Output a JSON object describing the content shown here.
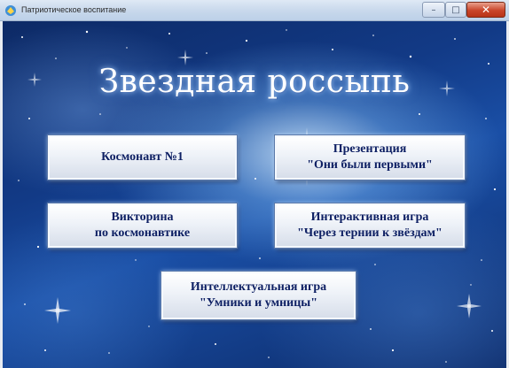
{
  "window": {
    "title": "Патриотическое воспитание",
    "icon": "app-icon",
    "controls": {
      "minimize": "–",
      "maximize": "□",
      "close": "✕"
    }
  },
  "main": {
    "heading": "Звездная россыпь",
    "buttons": [
      {
        "line1": "Космонавт №1",
        "line2": ""
      },
      {
        "line1": "Презентация",
        "line2": "\"Они были первыми\""
      },
      {
        "line1": "Викторина",
        "line2": "по космонавтике"
      },
      {
        "line1": "Интерактивная игра",
        "line2": "\"Через тернии к звёздам\""
      },
      {
        "line1": "Интеллектуальная игра",
        "line2": "\"Умники и умницы\""
      }
    ]
  },
  "colors": {
    "button_text": "#0d1f63",
    "background": "#123a86",
    "close_button": "#c9452a"
  }
}
